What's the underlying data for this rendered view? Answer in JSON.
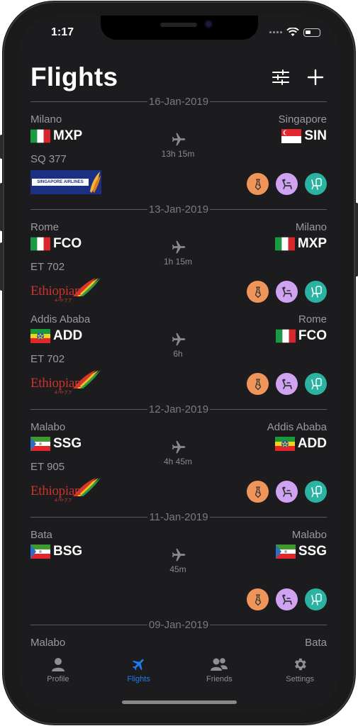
{
  "status": {
    "time": "1:17"
  },
  "header": {
    "title": "Flights",
    "filter_icon": "sliders-icon",
    "add_icon": "plus-icon"
  },
  "groups": [
    {
      "date": "16-Jan-2019",
      "flights": [
        {
          "from_city": "Milano",
          "from_code": "MXP",
          "from_flag": "italy",
          "to_city": "Singapore",
          "to_code": "SIN",
          "to_flag": "singapore",
          "duration": "13h 15m",
          "flight_no": "SQ 377",
          "airline": "SINGAPORE AIRLINES"
        }
      ]
    },
    {
      "date": "13-Jan-2019",
      "flights": [
        {
          "from_city": "Rome",
          "from_code": "FCO",
          "from_flag": "italy",
          "to_city": "Milano",
          "to_code": "MXP",
          "to_flag": "italy",
          "duration": "1h 15m",
          "flight_no": "ET 702",
          "airline": "Ethiopian"
        },
        {
          "from_city": "Addis Ababa",
          "from_code": "ADD",
          "from_flag": "ethiopia",
          "to_city": "Rome",
          "to_code": "FCO",
          "to_flag": "italy",
          "duration": "6h",
          "flight_no": "ET 702",
          "airline": "Ethiopian"
        }
      ]
    },
    {
      "date": "12-Jan-2019",
      "flights": [
        {
          "from_city": "Malabo",
          "from_code": "SSG",
          "from_flag": "equatorial-guinea",
          "to_city": "Addis Ababa",
          "to_code": "ADD",
          "to_flag": "ethiopia",
          "duration": "4h 45m",
          "flight_no": "ET 905",
          "airline": "Ethiopian"
        }
      ]
    },
    {
      "date": "11-Jan-2019",
      "flights": [
        {
          "from_city": "Bata",
          "from_code": "BSG",
          "from_flag": "equatorial-guinea",
          "to_city": "Malabo",
          "to_code": "SSG",
          "to_flag": "equatorial-guinea",
          "duration": "45m",
          "flight_no": "",
          "airline": ""
        }
      ]
    },
    {
      "date": "09-Jan-2019",
      "flights": [
        {
          "from_city": "Malabo",
          "from_code": "",
          "from_flag": "",
          "to_city": "Bata",
          "to_code": "",
          "to_flag": "",
          "duration": "",
          "flight_no": "",
          "airline": ""
        }
      ]
    }
  ],
  "badges": [
    {
      "icon": "tie-icon",
      "color": "#f0955a"
    },
    {
      "icon": "seat-icon",
      "color": "#cfa2f2"
    },
    {
      "icon": "window-seat-icon",
      "color": "#2ab3a0"
    }
  ],
  "ethiopian_script": "ፊሳነ፡ፓፓ",
  "tabs": [
    {
      "label": "Profile",
      "icon": "person-icon",
      "active": false
    },
    {
      "label": "Flights",
      "icon": "airplane-icon",
      "active": true
    },
    {
      "label": "Friends",
      "icon": "people-icon",
      "active": false
    },
    {
      "label": "Settings",
      "icon": "gear-icon",
      "active": false
    }
  ],
  "colors": {
    "accent": "#1e7cf2",
    "background": "#1c1c1e"
  }
}
